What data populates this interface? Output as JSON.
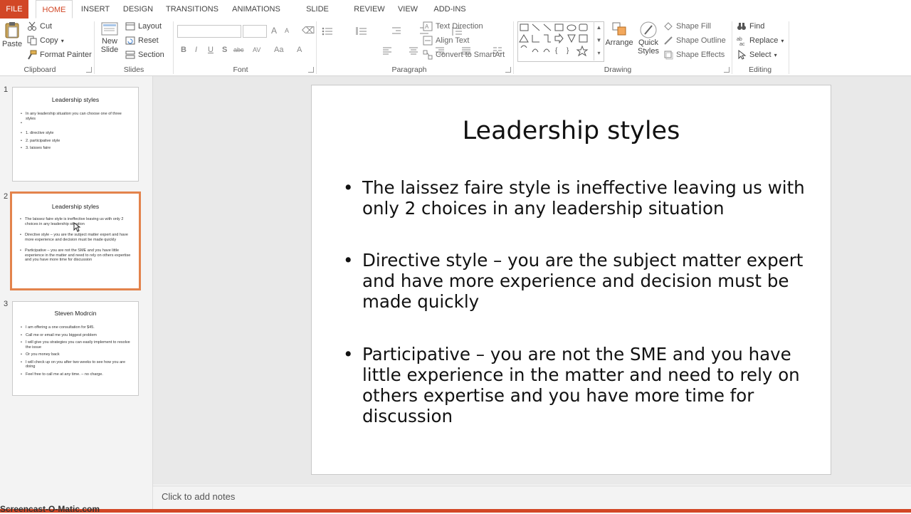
{
  "tabs": [
    "FILE",
    "HOME",
    "INSERT",
    "DESIGN",
    "TRANSITIONS",
    "ANIMATIONS",
    "SLIDE SHOW",
    "REVIEW",
    "VIEW",
    "ADD-INS"
  ],
  "ribbon": {
    "clipboard": {
      "paste": "Paste",
      "cut": "Cut",
      "copy": "Copy",
      "format_painter": "Format Painter",
      "label": "Clipboard"
    },
    "slides": {
      "new_slide_1": "New",
      "new_slide_2": "Slide",
      "layout": "Layout",
      "reset": "Reset",
      "section": "Section",
      "label": "Slides"
    },
    "font": {
      "label": "Font",
      "bold": "B",
      "italic": "I",
      "underline": "U",
      "shadow": "S",
      "strike": "abc",
      "spacing": "AV",
      "case": "Aa",
      "color": "A",
      "grow": "A",
      "shrink": "A"
    },
    "paragraph": {
      "text_direction": "Text Direction",
      "align_text": "Align Text",
      "convert_smartart": "Convert to SmartArt",
      "label": "Paragraph"
    },
    "drawing": {
      "arrange": "Arrange",
      "quick_1": "Quick",
      "quick_2": "Styles",
      "shape_fill": "Shape Fill",
      "shape_outline": "Shape Outline",
      "shape_effects": "Shape Effects",
      "label": "Drawing"
    },
    "editing": {
      "find": "Find",
      "replace": "Replace",
      "select": "Select",
      "label": "Editing"
    }
  },
  "thumbnails": [
    {
      "num": "1",
      "title": "Leadership styles",
      "lines": [
        "In any leadership situation you can choose one of three styles",
        "",
        "1. directive style",
        "2. participative style",
        "3. laisses faire"
      ]
    },
    {
      "num": "2",
      "title": "Leadership styles",
      "lines": [
        "The laissez faire style is ineffective leaving us with only 2 choices in any leadership situation",
        "Directive style – you are the subject matter expert and have more experience and decision must be made quickly",
        "Participative – you are not the SME and you have little experience in the matter and need to rely on others expertise and you have more time for discussion"
      ]
    },
    {
      "num": "3",
      "title": "Steven Modrcin",
      "lines": [
        "I am offering a one consultation for $45.",
        "Call me or email me you biggest problem",
        "I will give you strategies you can easily implement to resolve the issue",
        "Or you money back",
        "I will check up on you after two weeks to see how you are doing",
        "Feel free to call me at  any time. – no charge."
      ]
    }
  ],
  "slide": {
    "title": "Leadership styles",
    "bullets": [
      "The laissez faire style is ineffective leaving us with only 2 choices in any leadership situation",
      "Directive style – you are the subject matter expert and have more experience and decision must be made quickly",
      "Participative – you are not the SME and you have little experience in the matter and need to rely on others expertise and you have more time for discussion"
    ]
  },
  "notes_placeholder": "Click to add notes",
  "watermark": "Screencast-O-Matic.com",
  "colors": {
    "accent": "#d24726",
    "selection": "#e3834c"
  }
}
